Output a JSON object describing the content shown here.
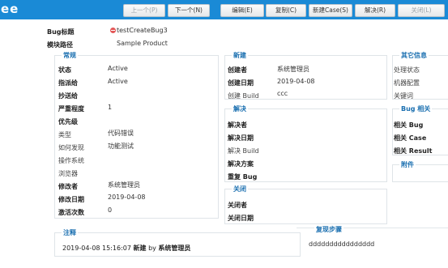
{
  "app": {
    "brand": "ee"
  },
  "toolbar": {
    "prev": "上一个(P)",
    "next": "下一个(N)",
    "edit": "编辑(E)",
    "copy": "复制(C)",
    "new_case": "新建Case(S)",
    "resolve": "解决(R)",
    "close": "关闭(L)"
  },
  "header": {
    "bug_title_label": "Bug标题",
    "bug_title_value": "testCreateBug3",
    "module_label": "模块路径",
    "module_value": "Sample Product"
  },
  "general": {
    "legend": "常规",
    "fields": [
      {
        "label": "状态",
        "value": "Active"
      },
      {
        "label": "指派给",
        "value": "Active"
      },
      {
        "label": "抄送给",
        "value": ""
      },
      {
        "label": "严重程度",
        "value": "1"
      },
      {
        "label": "优先级",
        "value": ""
      },
      {
        "label": "类型",
        "value": "代码错误"
      },
      {
        "label": "如何发现",
        "value": "功能测试"
      },
      {
        "label": "操作系统",
        "value": ""
      },
      {
        "label": "浏览器",
        "value": ""
      },
      {
        "label": "修改者",
        "value": "系统管理员"
      },
      {
        "label": "修改日期",
        "value": "2019-04-08"
      },
      {
        "label": "激活次数",
        "value": "0"
      }
    ]
  },
  "new_section": {
    "legend": "新建",
    "fields": [
      {
        "label": "创建者",
        "value": "系统管理员"
      },
      {
        "label": "创建日期",
        "value": "2019-04-08"
      },
      {
        "label": "创建 Build",
        "value": "ccc"
      }
    ]
  },
  "resolve_section": {
    "legend": "解决",
    "fields": [
      "解决者",
      "解决日期",
      "解决 Build",
      "解决方案",
      "重复 Bug"
    ]
  },
  "close_section": {
    "legend": "关闭",
    "fields": [
      "关闭者",
      "关闭日期"
    ]
  },
  "other_section": {
    "legend": "其它信息",
    "fields": [
      "处理状态",
      "机器配置",
      "关键词"
    ]
  },
  "bug_related": {
    "legend": "Bug 相关",
    "fields": [
      "相关 Bug",
      "相关 Case",
      "相关 Result"
    ]
  },
  "attachments": {
    "legend": "附件"
  },
  "notes": {
    "legend": "注释",
    "entry_time": "2019-04-08 15:16:07",
    "entry_action": "新建",
    "entry_by": "by",
    "entry_user": "系统管理员"
  },
  "repro": {
    "legend": "复现步骤",
    "content": "dddddddddddddddd"
  },
  "colors": {
    "topbar": "#1a8ad6",
    "legend": "#1a6fb0",
    "bug_icon": "#e35757"
  },
  "icons": [
    "bug-icon"
  ]
}
